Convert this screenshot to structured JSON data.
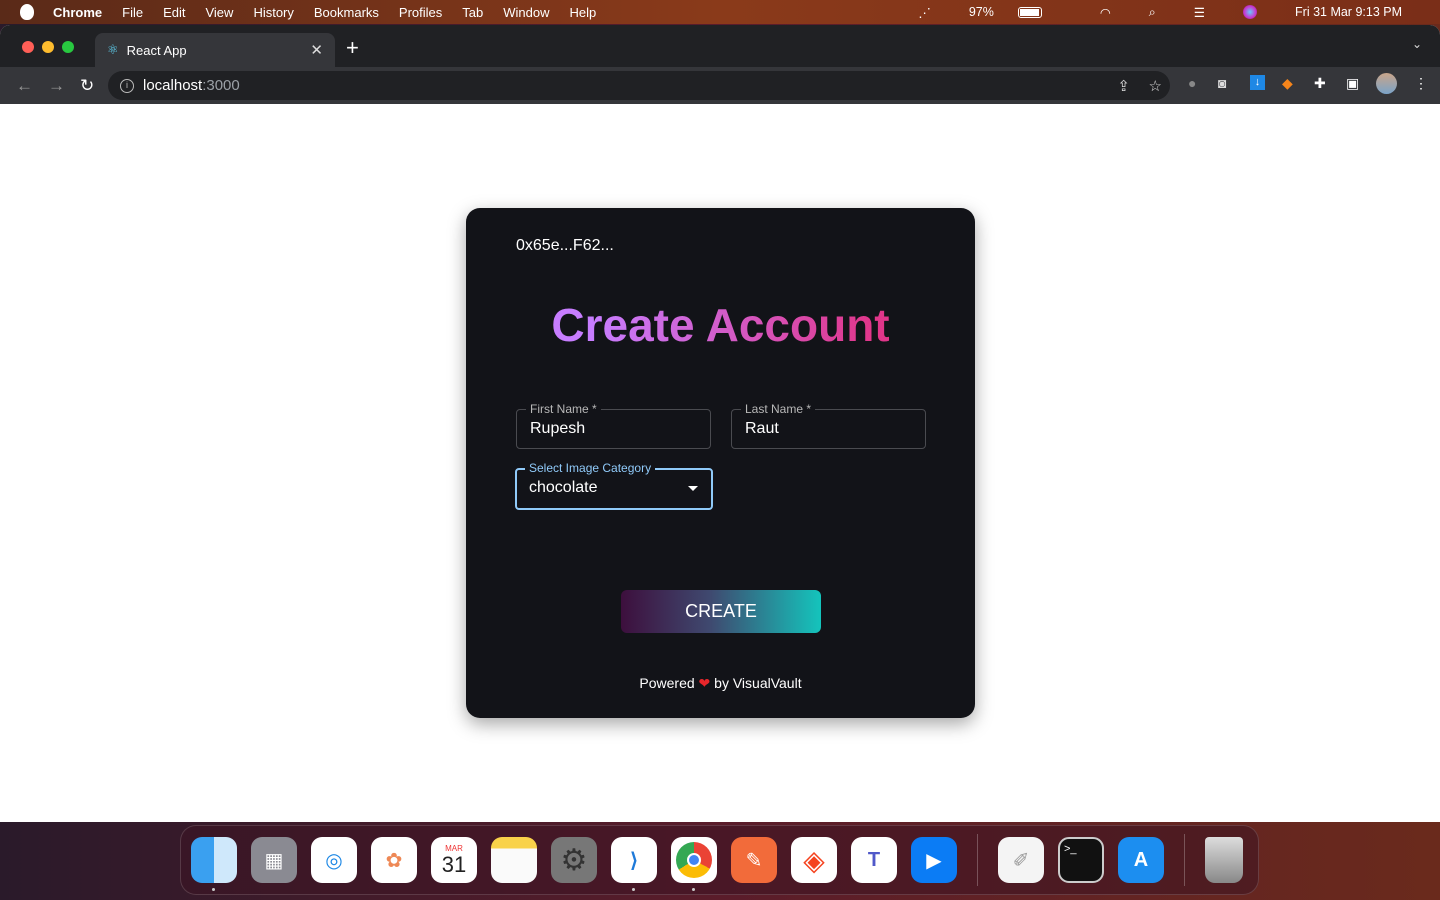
{
  "menubar": {
    "app": "Chrome",
    "items": [
      "File",
      "Edit",
      "View",
      "History",
      "Bookmarks",
      "Profiles",
      "Tab",
      "Window",
      "Help"
    ],
    "battery": "97%",
    "datetime": "Fri 31 Mar  9:13 PM"
  },
  "browser": {
    "tab_title": "React App",
    "url_host": "localhost",
    "url_port": ":3000"
  },
  "card": {
    "wallet": "0x65e...F62...",
    "title": "Create Account",
    "first_name": {
      "label": "First Name *",
      "value": "Rupesh"
    },
    "last_name": {
      "label": "Last Name *",
      "value": "Raut"
    },
    "category": {
      "label": "Select Image Category",
      "value": "chocolate"
    },
    "create_label": "CREATE",
    "powered_prefix": "Powered",
    "heart": "❤",
    "powered_suffix": "by VisualVault"
  },
  "dock": {
    "calendar_month": "MAR",
    "calendar_day": "31",
    "apps": [
      "finder",
      "launchpad",
      "safari",
      "photos",
      "calendar",
      "notes",
      "system-settings",
      "vscode",
      "chrome",
      "postman",
      "brave",
      "teams",
      "zoom",
      "textedit",
      "terminal",
      "app-store",
      "trash"
    ]
  }
}
